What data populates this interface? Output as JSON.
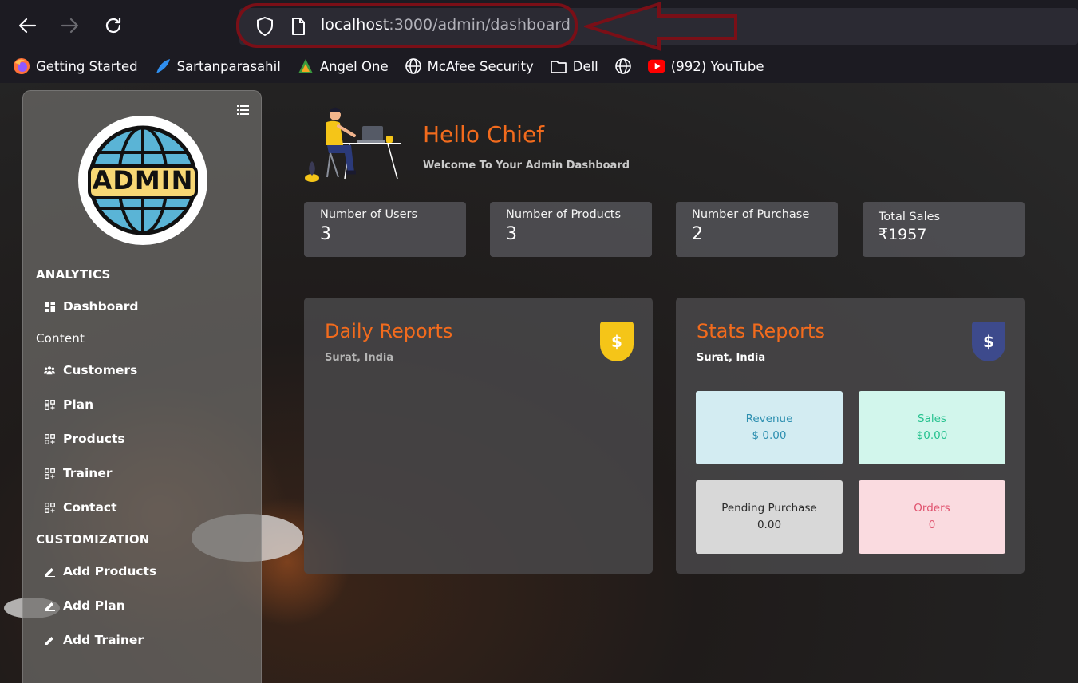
{
  "browser": {
    "url_host": "localhost",
    "url_path": ":3000/admin/dashboard",
    "bookmarks": [
      {
        "label": "Getting Started",
        "icon": "firefox-icon"
      },
      {
        "label": "Sartanparasahil",
        "icon": "feather-icon"
      },
      {
        "label": "Angel One",
        "icon": "angel-one-icon"
      },
      {
        "label": "McAfee Security",
        "icon": "globe-icon"
      },
      {
        "label": "Dell",
        "icon": "folder-icon"
      },
      {
        "label": "",
        "icon": "globe-icon"
      },
      {
        "label": "(992) YouTube",
        "icon": "youtube-icon"
      }
    ]
  },
  "sidebar": {
    "logo_text": "ADMIN",
    "sections": {
      "analytics": "ANALYTICS",
      "content": "Content",
      "customization": "CUSTOMIZATION"
    },
    "items": {
      "dashboard": "Dashboard",
      "customers": "Customers",
      "plan": "Plan",
      "products": "Products",
      "trainer": "Trainer",
      "contact": "Contact",
      "add_products": "Add Products",
      "add_plan": "Add Plan",
      "add_trainer": "Add Trainer"
    }
  },
  "header": {
    "greeting": "Hello Chief",
    "subtitle": "Welcome To Your Admin Dashboard"
  },
  "stats": [
    {
      "label": "Number of Users",
      "value": "3"
    },
    {
      "label": "Number of Products",
      "value": "3"
    },
    {
      "label": "Number of Purchase",
      "value": "2"
    },
    {
      "label": "Total Sales",
      "value": "₹1957"
    }
  ],
  "daily_report": {
    "title": "Daily Reports",
    "location": "Surat, India",
    "badge": "$",
    "badge_color": "#f5c518"
  },
  "stats_report": {
    "title": "Stats Reports",
    "location": "Surat, India",
    "badge": "$",
    "badge_color": "#3d4a8c",
    "cards": {
      "revenue": {
        "label": "Revenue",
        "value": "$ 0.00"
      },
      "sales": {
        "label": "Sales",
        "value": "$0.00"
      },
      "pending": {
        "label": "Pending Purchase",
        "value": "0.00"
      },
      "orders": {
        "label": "Orders",
        "value": "0"
      }
    }
  },
  "colors": {
    "accent": "#f26b1d",
    "revenue_bg": "#d3ecf2",
    "sales_bg": "#d2f6ec",
    "pending_bg": "#d8d8d8",
    "orders_bg": "#fadbe0"
  }
}
